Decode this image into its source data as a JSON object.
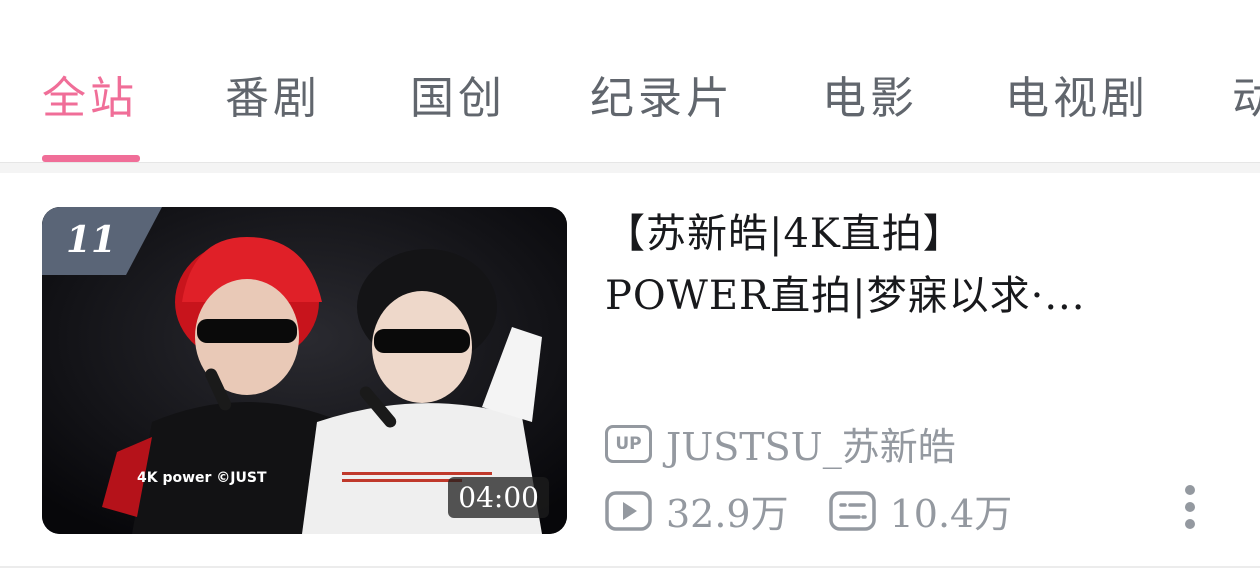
{
  "tabs": [
    {
      "label": "全站",
      "active": true
    },
    {
      "label": "番剧",
      "active": false
    },
    {
      "label": "国创",
      "active": false
    },
    {
      "label": "纪录片",
      "active": false
    },
    {
      "label": "电影",
      "active": false
    },
    {
      "label": "电视剧",
      "active": false
    },
    {
      "label": "动",
      "active": false
    }
  ],
  "accent_color": "#f06e98",
  "video": {
    "rank": "11",
    "duration": "04:00",
    "title_line1": "【苏新皓|4K直拍】",
    "title_line2": "POWER直拍|梦寐以求·...",
    "uploader_icon": "UP",
    "uploader": "JUSTSU_苏新皓",
    "views": "32.9万",
    "danmaku": "10.4万",
    "thumbnail_overlay_text": "4K  power  ©JUST"
  }
}
